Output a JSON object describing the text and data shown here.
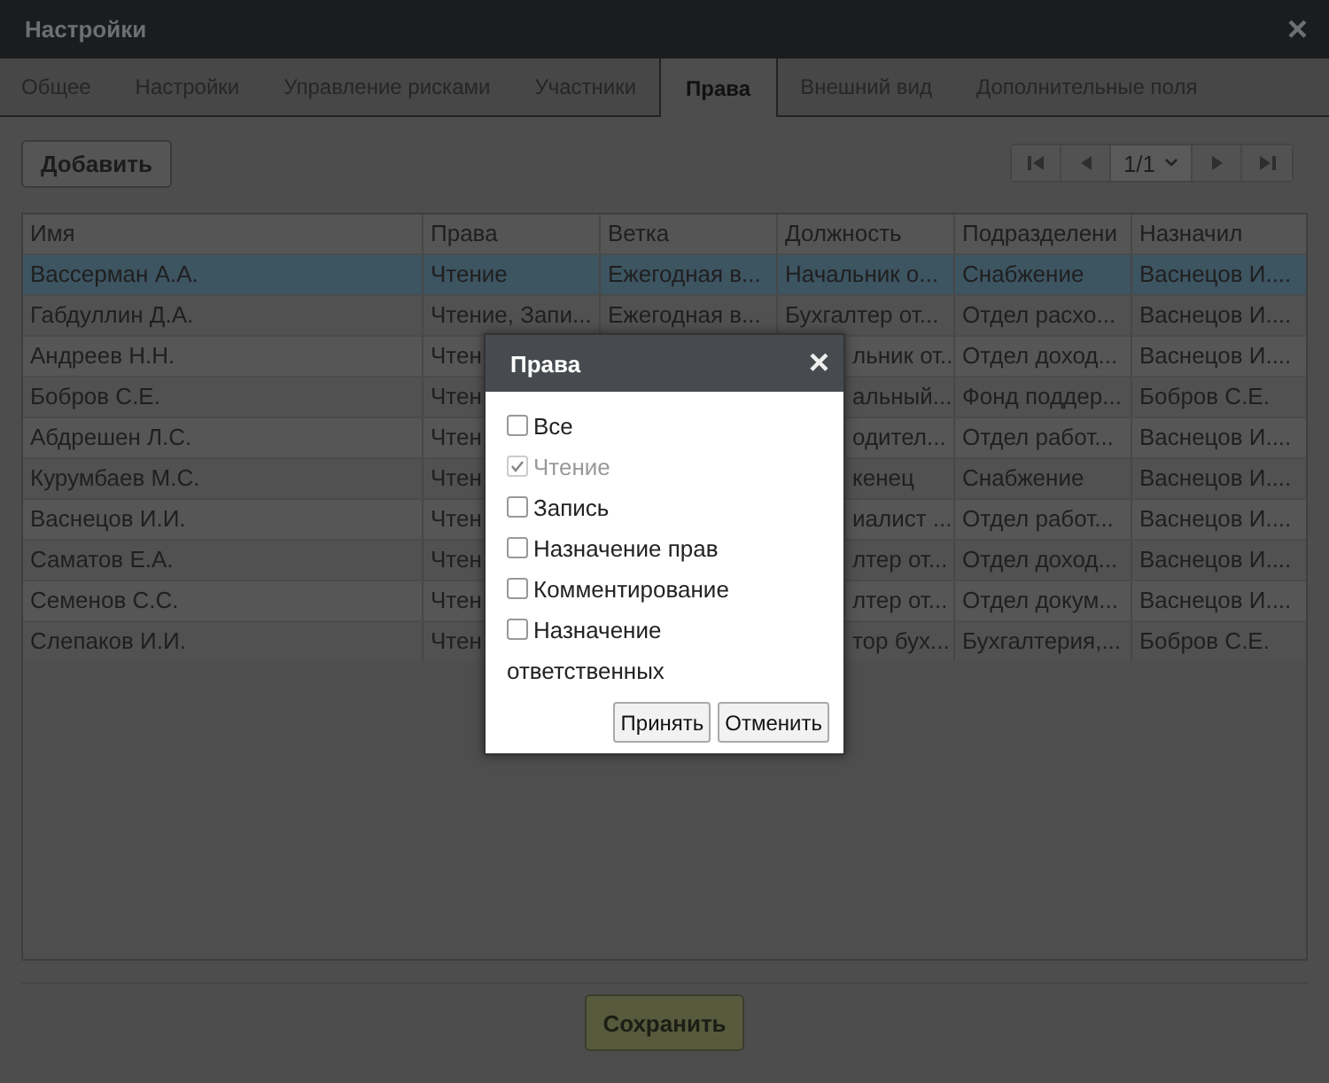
{
  "window": {
    "title": "Настройки",
    "close": "×"
  },
  "tabs": [
    {
      "label": "Общее",
      "selected": false
    },
    {
      "label": "Настройки",
      "selected": false
    },
    {
      "label": "Управление рисками",
      "selected": false
    },
    {
      "label": "Участники",
      "selected": false
    },
    {
      "label": "Права",
      "selected": true
    },
    {
      "label": "Внешний вид",
      "selected": false
    },
    {
      "label": "Дополнительные поля",
      "selected": false
    }
  ],
  "toolbar": {
    "add_button": "Добавить",
    "pager": {
      "page": "1/1"
    }
  },
  "table": {
    "columns": [
      "Имя",
      "Права",
      "Ветка",
      "Должность",
      "Подразделени",
      "Назначил"
    ],
    "rows": [
      {
        "selected": true,
        "partial": false,
        "cells": [
          "Вассерман А.А.",
          "Чтение",
          "Ежегодная в...",
          "Начальник о...",
          "Снабжение",
          "Васнецов И...."
        ]
      },
      {
        "selected": false,
        "partial": false,
        "cells": [
          "Габдуллин Д.А.",
          "Чтение, Запи...",
          "Ежегодная в...",
          "Бухгалтер от...",
          "Отдел расхо...",
          "Васнецов И...."
        ]
      },
      {
        "selected": false,
        "partial": true,
        "cells": [
          "Андреев Н.Н.",
          "Чтен",
          null,
          "льник от...",
          "Отдел доход...",
          "Васнецов И...."
        ]
      },
      {
        "selected": false,
        "partial": true,
        "cells": [
          "Бобров С.Е.",
          "Чтен",
          null,
          "альный...",
          "Фонд поддер...",
          "Бобров С.Е."
        ]
      },
      {
        "selected": false,
        "partial": true,
        "cells": [
          "Абдрешен Л.С.",
          "Чтен",
          null,
          "одител...",
          "Отдел работ...",
          "Васнецов И...."
        ]
      },
      {
        "selected": false,
        "partial": true,
        "cells": [
          "Курумбаев М.С.",
          "Чтен",
          null,
          "кенец",
          "Снабжение",
          "Васнецов И...."
        ]
      },
      {
        "selected": false,
        "partial": true,
        "cells": [
          "Васнецов И.И.",
          "Чтен",
          null,
          "иалист ...",
          "Отдел работ...",
          "Васнецов И...."
        ]
      },
      {
        "selected": false,
        "partial": true,
        "cells": [
          "Саматов Е.А.",
          "Чтен",
          null,
          "лтер от...",
          "Отдел доход...",
          "Васнецов И...."
        ]
      },
      {
        "selected": false,
        "partial": true,
        "cells": [
          "Семенов С.С.",
          "Чтен",
          null,
          "лтер от...",
          "Отдел докум...",
          "Васнецов И...."
        ]
      },
      {
        "selected": false,
        "partial": true,
        "cells": [
          "Слепаков И.И.",
          "Чтен",
          null,
          "тор бух...",
          "Бухгалтерия,...",
          "Бобров С.Е."
        ]
      }
    ]
  },
  "save_button": "Сохранить",
  "dialog": {
    "title": "Права",
    "close": "×",
    "options": [
      {
        "label": "Все",
        "checked": false,
        "disabled": false
      },
      {
        "label": "Чтение",
        "checked": true,
        "disabled": true
      },
      {
        "label": "Запись",
        "checked": false,
        "disabled": false
      },
      {
        "label": "Назначение прав",
        "checked": false,
        "disabled": false
      },
      {
        "label": "Комментирование",
        "checked": false,
        "disabled": false
      },
      {
        "label": "Назначение ответственных",
        "checked": false,
        "disabled": false
      }
    ],
    "buttons": [
      "Принять",
      "Отменить"
    ]
  }
}
